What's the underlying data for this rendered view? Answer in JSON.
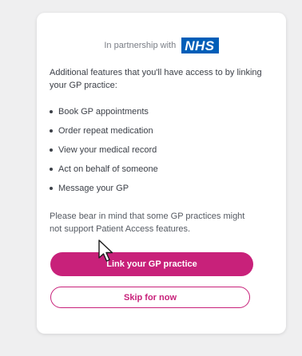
{
  "partnership": {
    "text": "In partnership with",
    "logo_text": "NHS",
    "logo_color": "#005eb8"
  },
  "intro": "Additional features that you'll have access to by linking your GP practice:",
  "features": [
    "Book GP appointments",
    "Order repeat medication",
    "View your medical record",
    "Act on behalf of someone",
    "Message your GP"
  ],
  "note": "Please bear in mind that some GP practices might not support Patient Access features.",
  "buttons": {
    "link_label": "Link your GP practice",
    "skip_label": "Skip for now",
    "accent_color": "#c8217a"
  },
  "cursor": {
    "icon": "arrow-pointer-icon"
  }
}
